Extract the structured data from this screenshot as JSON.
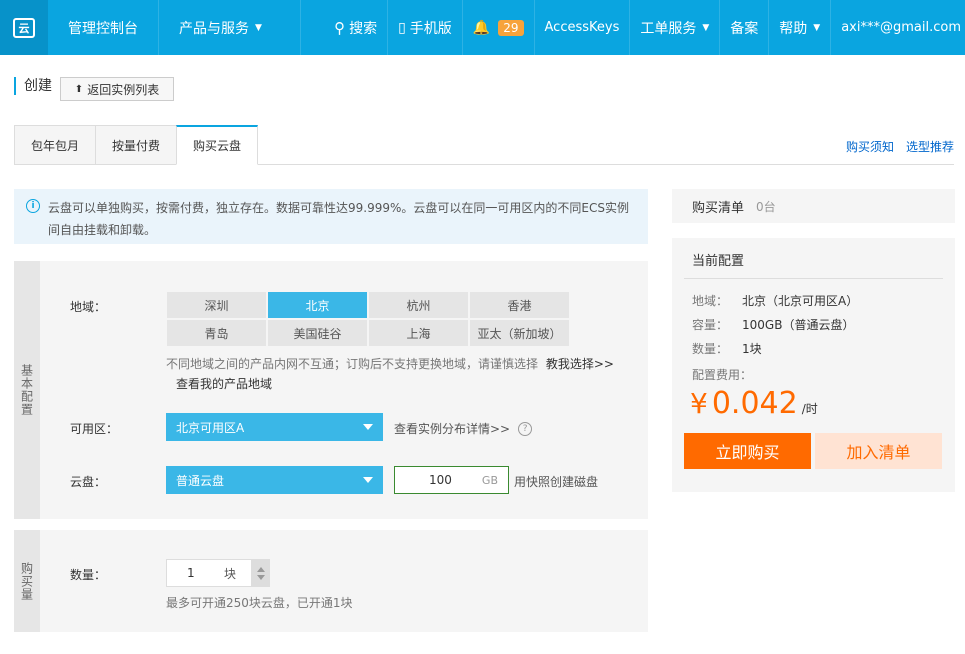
{
  "nav": {
    "logo": "云",
    "console": "管理控制台",
    "products": "产品与服务",
    "search": "搜索",
    "mobile": "手机版",
    "notification_count": "29",
    "accesskeys": "AccessKeys",
    "tickets": "工单服务",
    "record": "备案",
    "help": "帮助",
    "user": "axi***@gmail.com"
  },
  "header": {
    "title": "创建",
    "back_button": "返回实例列表"
  },
  "tabs": [
    "包年包月",
    "按量付费",
    "购买云盘"
  ],
  "active_tab": "购买云盘",
  "top_links": {
    "purchase_notes": "购买须知",
    "selection_guide": "选型推荐"
  },
  "notice": "云盘可以单独购买，按需付费，独立存在。数据可靠性达99.999%。云盘可以在同一可用区内的不同ECS实例间自由挂载和卸载。",
  "basic": {
    "side_label": "基本配置",
    "region_label": "地域：",
    "regions": [
      "深圳",
      "北京",
      "杭州",
      "香港",
      "青岛",
      "美国硅谷",
      "上海",
      "亚太（新加坡）"
    ],
    "selected_region": "北京",
    "region_hint": "不同地域之间的产品内网不互通；订购后不支持更换地域，请谨慎选择",
    "region_hint_link": "教我选择>>",
    "region_hint_tail": "查看我的产品地域",
    "zone_label": "可用区：",
    "zone_value": "北京可用区A",
    "zone_link": "查看实例分布详情>>",
    "disk_label": "云盘：",
    "disk_type": "普通云盘",
    "disk_size": "100",
    "disk_unit": "GB",
    "snapshot_link": "用快照创建磁盘"
  },
  "purchase": {
    "side_label": "购买量",
    "qty_label": "数量：",
    "qty_value": "1",
    "qty_unit": "块",
    "qty_hint": "最多可开通250块云盘，已开通1块"
  },
  "cart": {
    "title": "购买清单",
    "count": "0台",
    "config_title": "当前配置",
    "region_key": "地域：",
    "region_val": "北京（北京可用区A）",
    "capacity_key": "容量：",
    "capacity_val": "100GB（普通云盘）",
    "qty_key": "数量：",
    "qty_val": "1块",
    "fee_key": "配置费用：",
    "currency": "¥",
    "price": "0.042",
    "per": "/时",
    "buy_button": "立即购买",
    "add_button": "加入清单"
  }
}
